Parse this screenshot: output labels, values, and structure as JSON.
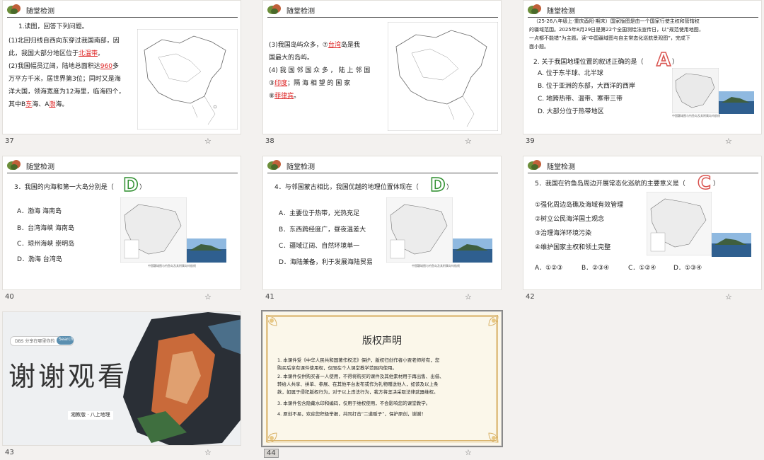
{
  "header_title": "随堂检测",
  "slides": {
    "s37": {
      "number": "37",
      "q_intro": "1.读图，回答下列问题。",
      "l1a": "(1)北回归线自西向东穿过我国南部，因",
      "l1b_pre": "此，我国大部分地区位于",
      "l1b_ans": "北温带",
      "l1b_post": "。",
      "l2a_pre": "(2)我国幅员辽阔，陆地总面积达",
      "l2a_ans": "960",
      "l2a_post": "多",
      "l3": "万平方千米，居世界第3位；同时又是海",
      "l4": "洋大国，领海宽度为12海里，临海四个，",
      "l5_pre": "其中B",
      "l5_ans1": "东",
      "l5_mid": "海、A",
      "l5_ans2": "渤",
      "l5_post": "海。"
    },
    "s38": {
      "number": "38",
      "l1_pre": "(3)我国岛屿众多，⑦",
      "l1_ans": "台湾",
      "l1_post": "岛是我",
      "l2": "国最大的岛屿。",
      "l3": "(4) 我 国 邻 国 众 多 ， 陆 上 邻 国",
      "l4_pre": "③",
      "l4_ans": "印度",
      "l4_post": "；隔 海 相 望 的 国 家",
      "l5_pre": "⑧",
      "l5_ans": "菲律宾",
      "l5_post": "。"
    },
    "s39": {
      "number": "39",
      "p1": "（25-26八年级上·重庆酉阳·期末）国家版图是由一个国家行使主权和管辖权",
      "p2": "的疆域范围。2025年8月29日是第22个全国测绘法宣传日，以“规范使用地图，",
      "p3": "一点都不能错”为主题。读“中国疆域图与自主常态化巡航景观图”，完成下",
      "p4": "面小题。",
      "question": "2. 关于我国地理位置的叙述正确的是（",
      "answer": "A",
      "q_close": "）",
      "options": [
        "A. 位于东半球、北半球",
        "B. 位于亚洲的东部，大西洋的西岸",
        "C. 地跨热带、温带、寒带三带",
        "D. 大部分位于热带地区"
      ]
    },
    "s40": {
      "number": "40",
      "question": "3．我国的内海和第一大岛分别是（",
      "answer": "D",
      "q_close": "）",
      "options": [
        "A．渤海  海南岛",
        "B．台湾海峡  海南岛",
        "C．琼州海峡  崇明岛",
        "D．渤海  台湾岛"
      ]
    },
    "s41": {
      "number": "41",
      "question": "4．与邻国蒙古相比，我国优越的地理位置体现在（",
      "answer": "D",
      "q_close": "）",
      "options": [
        "A．主要位于热带，光热充足",
        "B．东西跨经度广，昼夜温差大",
        "C．疆域辽阔、自然环境单一",
        "D．海陆兼备，利于发展海陆贸易"
      ]
    },
    "s42": {
      "number": "42",
      "question": "5．我国在钓鱼岛周边开展常态化巡航的主要意义是（",
      "answer": "C",
      "q_close": "）",
      "items": [
        "①强化周边岛礁及海域有效管理",
        "②树立公民海洋国土观念",
        "③治理海洋环境污染",
        "④维护国家主权和领土完整"
      ],
      "choices": [
        "A．①②③",
        "B．②③④",
        "C．①②④",
        "D．①③④"
      ]
    },
    "s43": {
      "number": "43",
      "search_placeholder": "DBS  分享在哪里你的",
      "search_button": "Search",
      "title": "谢谢观看",
      "subtitle": "湘教版 · 八上地理"
    },
    "s44": {
      "number": "44",
      "title": "版权声明",
      "lines": [
        "1. 本课件受《中华人民共和国著作权法》保护，版权归创作者小贾老师所有，您",
        "购买后享有课件使用权，仅限在个人课堂教学范围内使用。",
        "2. 本课件仅供购买者一人使用，不得将购买的课件及其他素材用于再出售、出借、",
        "转给人共享、拼单、参展、在其他平台发布或作为礼物赠送他人，如该及以上条",
        "款，如属于侵犯版权行为，对于以上违法行为，我方将坚决采取法律武器维权。",
        "3. 本课件包含隐藏水印和编码，仅用于维权使用，不会影响您的课堂教学。",
        "4. 原创不易，欢迎您积极举报，共同打击“二道贩子”，保护原创，谢谢！"
      ]
    }
  },
  "map_caption": "中国疆域图与钓鱼岛及其附属岛屿航线",
  "colors": {
    "answer_red": "#d22222",
    "answer_green": "#3a9a3a",
    "answer_D_outline": "#2f8f2f",
    "answer_A_outline": "#d9534f"
  }
}
